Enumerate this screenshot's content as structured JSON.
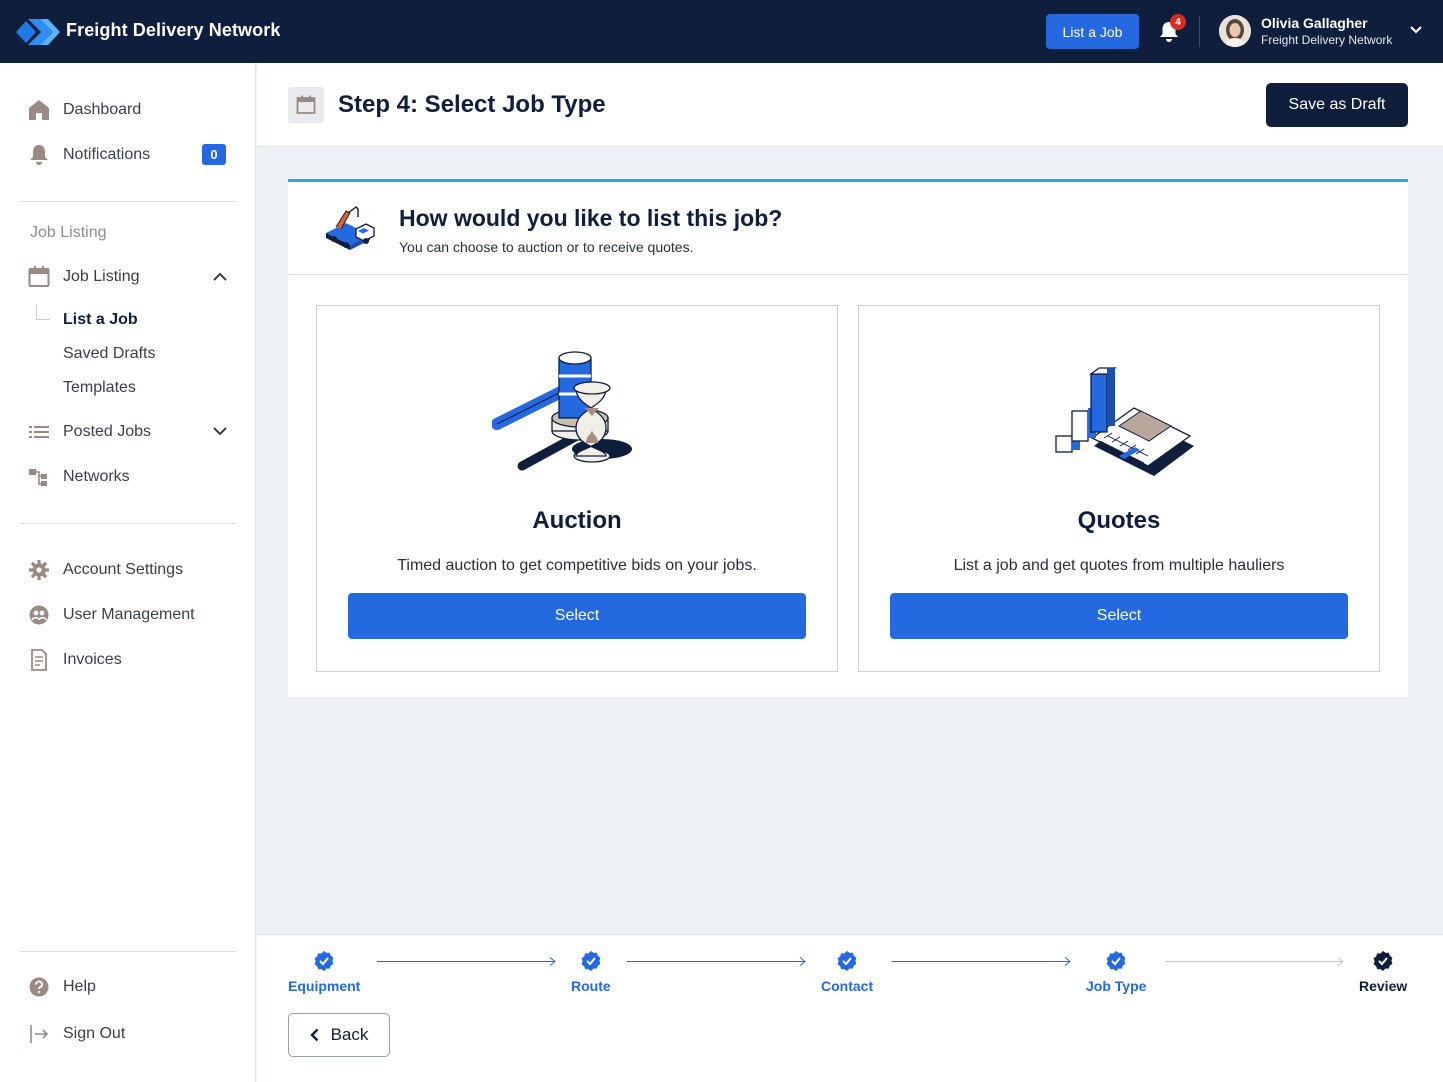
{
  "app": {
    "brand": "Freight Delivery Network",
    "list_job_button": "List a Job",
    "notification_count": "4",
    "user_name": "Olivia Gallagher",
    "user_org": "Freight Delivery Network"
  },
  "sidebar": {
    "dashboard": "Dashboard",
    "notifications": "Notifications",
    "notifications_count": "0",
    "section_label": "Job Listing",
    "job_listing": "Job Listing",
    "sub_items": [
      "List a Job",
      "Saved Drafts",
      "Templates"
    ],
    "posted_jobs": "Posted Jobs",
    "networks": "Networks",
    "account_settings": "Account Settings",
    "user_management": "User Management",
    "invoices": "Invoices",
    "help": "Help",
    "sign_out": "Sign Out"
  },
  "header": {
    "title": "Step 4: Select Job Type",
    "save_draft": "Save as Draft"
  },
  "question": {
    "title": "How would you like to list this job?",
    "subtitle": "You can choose to auction or to receive quotes."
  },
  "options": [
    {
      "title": "Auction",
      "description": "Timed auction to get competitive bids on your jobs.",
      "button": "Select"
    },
    {
      "title": "Quotes",
      "description": "List a job and get quotes from multiple hauliers",
      "button": "Select"
    }
  ],
  "stepper": {
    "steps": [
      "Equipment",
      "Route",
      "Contact",
      "Job Type",
      "Review"
    ],
    "back": "Back"
  },
  "colors": {
    "navy": "#0f1e3d",
    "primary": "#2469e0",
    "accent": "#27a9d9",
    "badge_red": "#d92d20"
  }
}
